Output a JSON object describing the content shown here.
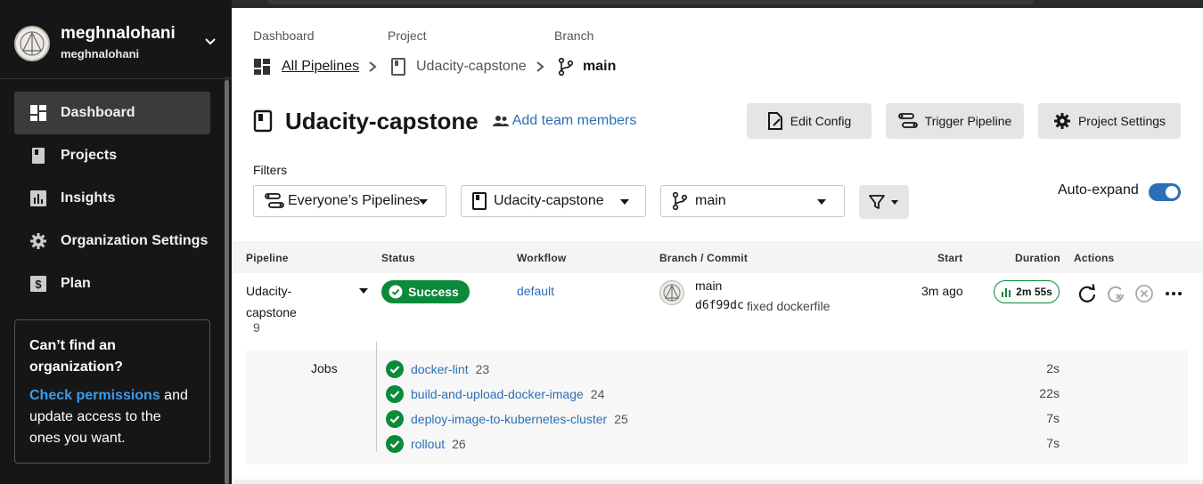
{
  "user": {
    "name": "meghnalohani",
    "handle": "meghnalohani"
  },
  "sidebar": {
    "items": [
      {
        "label": "Dashboard",
        "icon": "dashboard-icon",
        "active": true
      },
      {
        "label": "Projects",
        "icon": "book-icon"
      },
      {
        "label": "Insights",
        "icon": "bar-chart-icon"
      },
      {
        "label": "Organization Settings",
        "icon": "gear-icon"
      },
      {
        "label": "Plan",
        "icon": "dollar-icon"
      }
    ],
    "notice": {
      "title": "Can’t find an organization?",
      "link": "Check permissions",
      "body": " and update access to the ones you want."
    }
  },
  "breadcrumb": {
    "dashboard_head": "Dashboard",
    "project_head": "Project",
    "branch_head": "Branch",
    "all_pipelines": "All Pipelines",
    "project": "Udacity-capstone",
    "branch": "main"
  },
  "header": {
    "title": "Udacity-capstone",
    "add_team": "Add team members",
    "edit_config": "Edit Config",
    "trigger": "Trigger Pipeline",
    "settings": "Project Settings"
  },
  "filters": {
    "label": "Filters",
    "pipelines": "Everyone’s Pipelines",
    "project": "Udacity-capstone",
    "branch": "main",
    "auto_expand": "Auto-expand"
  },
  "table": {
    "headers": [
      "Pipeline",
      "Status",
      "Workflow",
      "Branch / Commit",
      "Start",
      "Duration",
      "Actions"
    ],
    "row": {
      "pipeline": "Udacity-capstone",
      "number": "9",
      "status": "Success",
      "workflow": "default",
      "branch": "main",
      "sha": "d6f99dc",
      "message": "fixed dockerfile",
      "start": "3m ago",
      "duration": "2m 55s"
    },
    "jobs_label": "Jobs",
    "jobs": [
      {
        "name": "docker-lint",
        "num": "23",
        "duration": "2s"
      },
      {
        "name": "build-and-upload-docker-image",
        "num": "24",
        "duration": "22s"
      },
      {
        "name": "deploy-image-to-kubernetes-cluster",
        "num": "25",
        "duration": "7s"
      },
      {
        "name": "rollout",
        "num": "26",
        "duration": "7s"
      }
    ]
  },
  "colors": {
    "success": "#0b8a3a",
    "link": "#2b6fb6",
    "sidebar": "#161616",
    "toggle": "#2b6fb6"
  }
}
